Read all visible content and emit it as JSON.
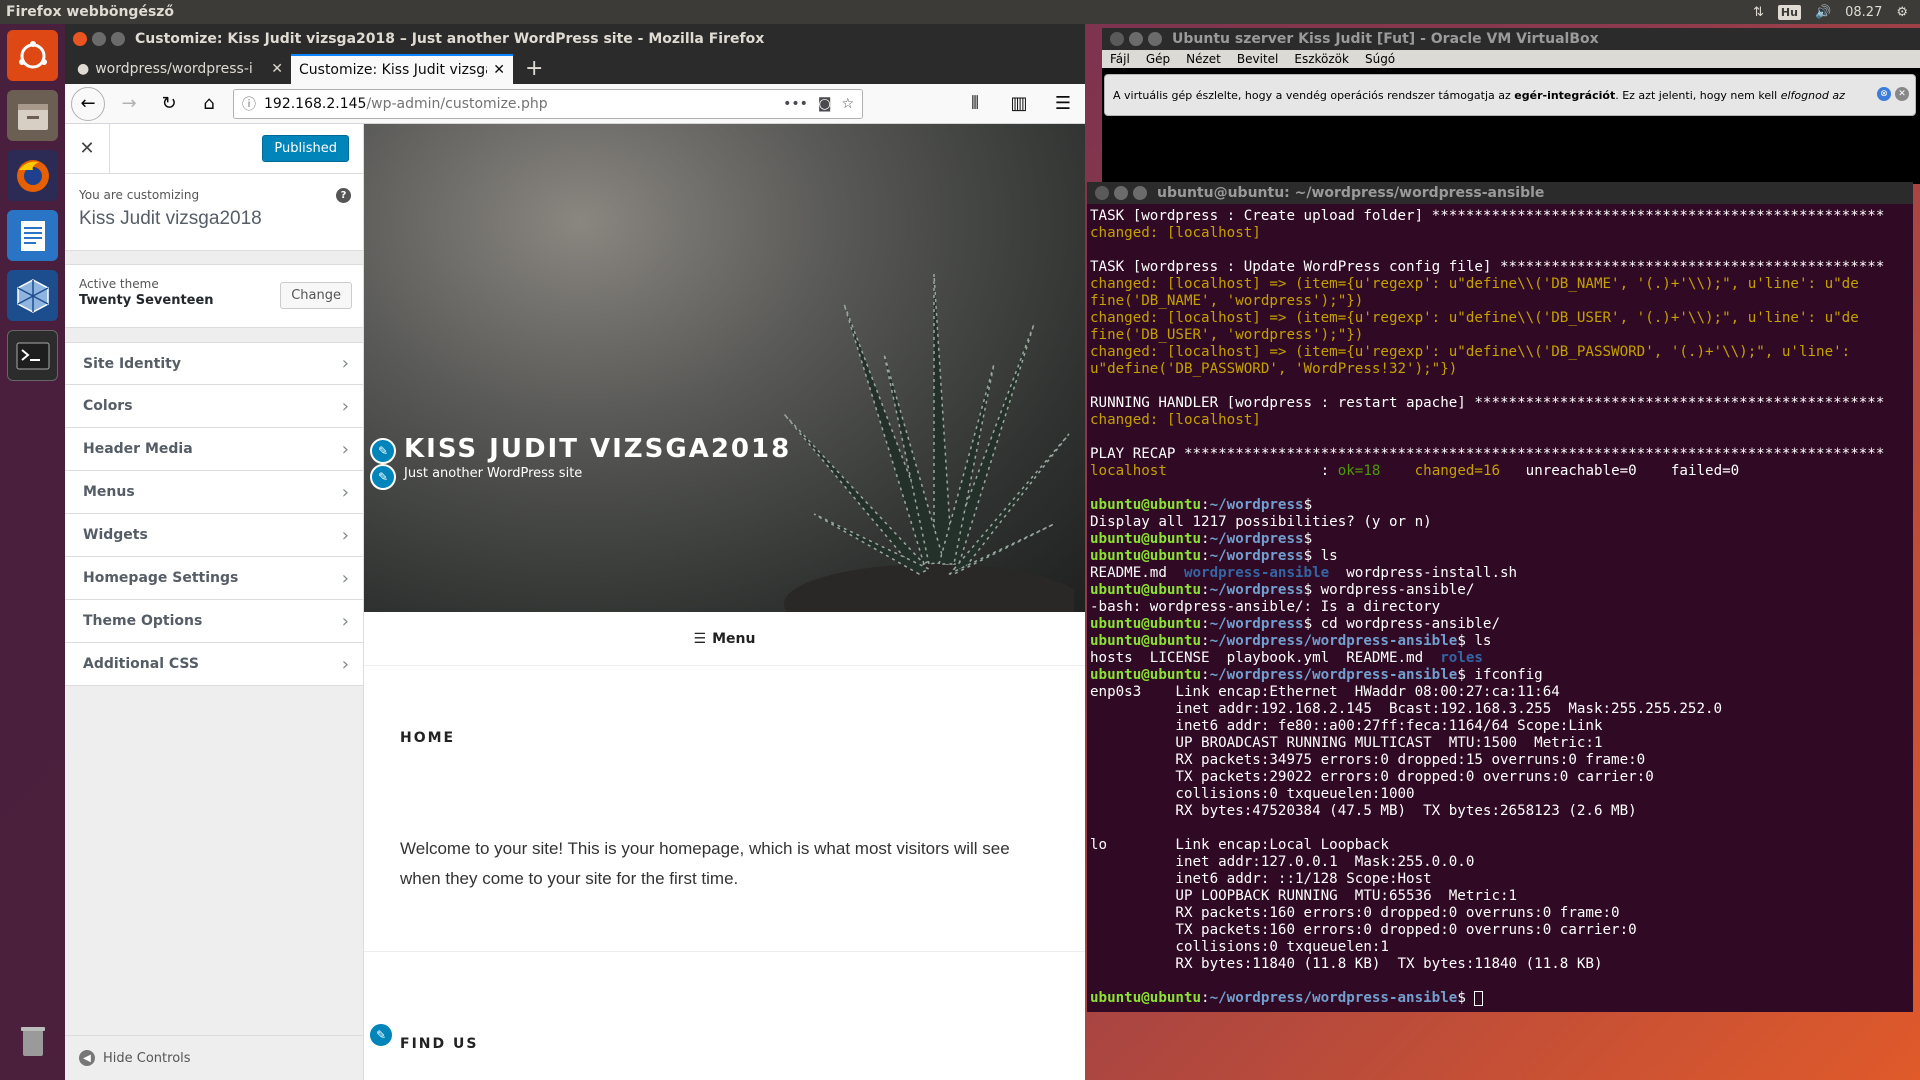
{
  "topbar": {
    "app_name": "Firefox webböngésző",
    "keyboard_layout": "Hu",
    "clock": "08.27"
  },
  "launcher": {
    "items": [
      {
        "name": "ubuntu-dash-icon",
        "color": "#dd4814"
      },
      {
        "name": "files-icon",
        "color": "#7a6a5a"
      },
      {
        "name": "firefox-icon",
        "color": "#e66000"
      },
      {
        "name": "writer-icon",
        "color": "#2a74c5"
      },
      {
        "name": "virtualbox-icon",
        "color": "#1c4e8e"
      },
      {
        "name": "terminal-icon",
        "color": "#2c2c2c"
      },
      {
        "name": "trash-icon",
        "color": "#8a8a8a"
      }
    ]
  },
  "firefox": {
    "title": "Customize: Kiss Judit vizsga2018 – Just another WordPress site - Mozilla Firefox",
    "tabs": [
      {
        "label": "wordpress/wordpress-i",
        "active": false
      },
      {
        "label": "Customize: Kiss Judit vizsga",
        "active": true
      }
    ],
    "url_host": "192.168.2.145",
    "url_path": "/wp-admin/customize.php"
  },
  "customizer": {
    "publish_label": "Published",
    "customizing_label": "You are customizing",
    "site_name": "Kiss Judit vizsga2018",
    "active_theme_label": "Active theme",
    "theme_name": "Twenty Seventeen",
    "change_label": "Change",
    "sections": [
      "Site Identity",
      "Colors",
      "Header Media",
      "Menus",
      "Widgets",
      "Homepage Settings",
      "Theme Options",
      "Additional CSS"
    ],
    "hide_controls_label": "Hide Controls"
  },
  "preview": {
    "site_title": "KISS JUDIT VIZSGA2018",
    "tagline": "Just another WordPress site",
    "menu_label": "Menu",
    "home_title": "HOME",
    "home_text": "Welcome to your site! This is your homepage, which is what most visitors will see when they come to your site for the first time.",
    "find_us_title": "FIND US"
  },
  "virtualbox": {
    "title": "Ubuntu szerver Kiss Judit [Fut] - Oracle VM VirtualBox",
    "menu": [
      "Fájl",
      "Gép",
      "Nézet",
      "Bevitel",
      "Eszközök",
      "Súgó"
    ],
    "notice_prefix": "A virtuális gép észlelte, hogy a vendég operációs rendszer támogatja az ",
    "notice_bold": "egér-integrációt",
    "notice_mid": ". Ez azt jelenti, hogy nem kell ",
    "notice_italic": "elfognod az"
  },
  "terminal": {
    "title": "ubuntu@ubuntu: ~/wordpress/wordpress-ansible",
    "lines": [
      {
        "segs": [
          [
            "TASK [wordpress : Create upload folder] *****************************************************",
            ""
          ]
        ]
      },
      {
        "segs": [
          [
            "changed: [localhost]",
            "c-changed"
          ]
        ]
      },
      {
        "segs": [
          [
            "",
            ""
          ]
        ]
      },
      {
        "segs": [
          [
            "TASK [wordpress : Update WordPress config file] *********************************************",
            ""
          ]
        ]
      },
      {
        "segs": [
          [
            "changed: [localhost] => (item={u'regexp': u\"define\\\\('DB_NAME', '(.)+'\\\\);\", u'line': u\"de",
            "c-changed"
          ]
        ]
      },
      {
        "segs": [
          [
            "fine('DB_NAME', 'wordpress');\"})",
            "c-changed"
          ]
        ]
      },
      {
        "segs": [
          [
            "changed: [localhost] => (item={u'regexp': u\"define\\\\('DB_USER', '(.)+'\\\\);\", u'line': u\"de",
            "c-changed"
          ]
        ]
      },
      {
        "segs": [
          [
            "fine('DB_USER', 'wordpress');\"})",
            "c-changed"
          ]
        ]
      },
      {
        "segs": [
          [
            "changed: [localhost] => (item={u'regexp': u\"define\\\\('DB_PASSWORD', '(.)+'\\\\);\", u'line':",
            "c-changed"
          ]
        ]
      },
      {
        "segs": [
          [
            "u\"define('DB_PASSWORD', 'WordPress!32');\"})",
            "c-changed"
          ]
        ]
      },
      {
        "segs": [
          [
            "",
            ""
          ]
        ]
      },
      {
        "segs": [
          [
            "RUNNING HANDLER [wordpress : restart apache] ************************************************",
            ""
          ]
        ]
      },
      {
        "segs": [
          [
            "changed: [localhost]",
            "c-changed"
          ]
        ]
      },
      {
        "segs": [
          [
            "",
            ""
          ]
        ]
      },
      {
        "segs": [
          [
            "PLAY RECAP **********************************************************************************",
            ""
          ]
        ]
      },
      {
        "segs": [
          [
            "localhost",
            "c-changed"
          ],
          [
            "                  : ",
            ""
          ],
          [
            "ok=18",
            "c-ok"
          ],
          [
            "    ",
            ""
          ],
          [
            "changed=16",
            "c-changed"
          ],
          [
            "   unreachable=0    failed=0",
            ""
          ]
        ]
      },
      {
        "segs": [
          [
            "",
            ""
          ]
        ]
      },
      {
        "segs": [
          [
            "ubuntu@ubuntu",
            "c-user"
          ],
          [
            ":",
            ""
          ],
          [
            "~/wordpress",
            "c-path"
          ],
          [
            "$",
            ""
          ]
        ]
      },
      {
        "segs": [
          [
            "Display all 1217 possibilities? (y or n)",
            ""
          ]
        ]
      },
      {
        "segs": [
          [
            "ubuntu@ubuntu",
            "c-user"
          ],
          [
            ":",
            ""
          ],
          [
            "~/wordpress",
            "c-path"
          ],
          [
            "$",
            ""
          ]
        ]
      },
      {
        "segs": [
          [
            "ubuntu@ubuntu",
            "c-user"
          ],
          [
            ":",
            ""
          ],
          [
            "~/wordpress",
            "c-path"
          ],
          [
            "$ ls",
            ""
          ]
        ]
      },
      {
        "segs": [
          [
            "README.md  ",
            ""
          ],
          [
            "wordpress-ansible",
            "c-dir"
          ],
          [
            "  wordpress-install.sh",
            ""
          ]
        ]
      },
      {
        "segs": [
          [
            "ubuntu@ubuntu",
            "c-user"
          ],
          [
            ":",
            ""
          ],
          [
            "~/wordpress",
            "c-path"
          ],
          [
            "$ wordpress-ansible/",
            ""
          ]
        ]
      },
      {
        "segs": [
          [
            "-bash: wordpress-ansible/: Is a directory",
            ""
          ]
        ]
      },
      {
        "segs": [
          [
            "ubuntu@ubuntu",
            "c-user"
          ],
          [
            ":",
            ""
          ],
          [
            "~/wordpress",
            "c-path"
          ],
          [
            "$ cd wordpress-ansible/",
            ""
          ]
        ]
      },
      {
        "segs": [
          [
            "ubuntu@ubuntu",
            "c-user"
          ],
          [
            ":",
            ""
          ],
          [
            "~/wordpress/wordpress-ansible",
            "c-path"
          ],
          [
            "$ ls",
            ""
          ]
        ]
      },
      {
        "segs": [
          [
            "hosts  LICENSE  playbook.yml  README.md  ",
            ""
          ],
          [
            "roles",
            "c-dir"
          ]
        ]
      },
      {
        "segs": [
          [
            "ubuntu@ubuntu",
            "c-user"
          ],
          [
            ":",
            ""
          ],
          [
            "~/wordpress/wordpress-ansible",
            "c-path"
          ],
          [
            "$ ifconfig",
            ""
          ]
        ]
      },
      {
        "segs": [
          [
            "enp0s3    Link encap:Ethernet  HWaddr 08:00:27:ca:11:64",
            ""
          ]
        ]
      },
      {
        "segs": [
          [
            "          inet addr:192.168.2.145  Bcast:192.168.3.255  Mask:255.255.252.0",
            ""
          ]
        ]
      },
      {
        "segs": [
          [
            "          inet6 addr: fe80::a00:27ff:feca:1164/64 Scope:Link",
            ""
          ]
        ]
      },
      {
        "segs": [
          [
            "          UP BROADCAST RUNNING MULTICAST  MTU:1500  Metric:1",
            ""
          ]
        ]
      },
      {
        "segs": [
          [
            "          RX packets:34975 errors:0 dropped:15 overruns:0 frame:0",
            ""
          ]
        ]
      },
      {
        "segs": [
          [
            "          TX packets:29022 errors:0 dropped:0 overruns:0 carrier:0",
            ""
          ]
        ]
      },
      {
        "segs": [
          [
            "          collisions:0 txqueuelen:1000",
            ""
          ]
        ]
      },
      {
        "segs": [
          [
            "          RX bytes:47520384 (47.5 MB)  TX bytes:2658123 (2.6 MB)",
            ""
          ]
        ]
      },
      {
        "segs": [
          [
            "",
            ""
          ]
        ]
      },
      {
        "segs": [
          [
            "lo        Link encap:Local Loopback",
            ""
          ]
        ]
      },
      {
        "segs": [
          [
            "          inet addr:127.0.0.1  Mask:255.0.0.0",
            ""
          ]
        ]
      },
      {
        "segs": [
          [
            "          inet6 addr: ::1/128 Scope:Host",
            ""
          ]
        ]
      },
      {
        "segs": [
          [
            "          UP LOOPBACK RUNNING  MTU:65536  Metric:1",
            ""
          ]
        ]
      },
      {
        "segs": [
          [
            "          RX packets:160 errors:0 dropped:0 overruns:0 frame:0",
            ""
          ]
        ]
      },
      {
        "segs": [
          [
            "          TX packets:160 errors:0 dropped:0 overruns:0 carrier:0",
            ""
          ]
        ]
      },
      {
        "segs": [
          [
            "          collisions:0 txqueuelen:1",
            ""
          ]
        ]
      },
      {
        "segs": [
          [
            "          RX bytes:11840 (11.8 KB)  TX bytes:11840 (11.8 KB)",
            ""
          ]
        ]
      },
      {
        "segs": [
          [
            "",
            ""
          ]
        ]
      },
      {
        "segs": [
          [
            "ubuntu@ubuntu",
            "c-user"
          ],
          [
            ":",
            ""
          ],
          [
            "~/wordpress/wordpress-ansible",
            "c-path"
          ],
          [
            "$ ",
            ""
          ]
        ],
        "cursor": true
      }
    ]
  }
}
